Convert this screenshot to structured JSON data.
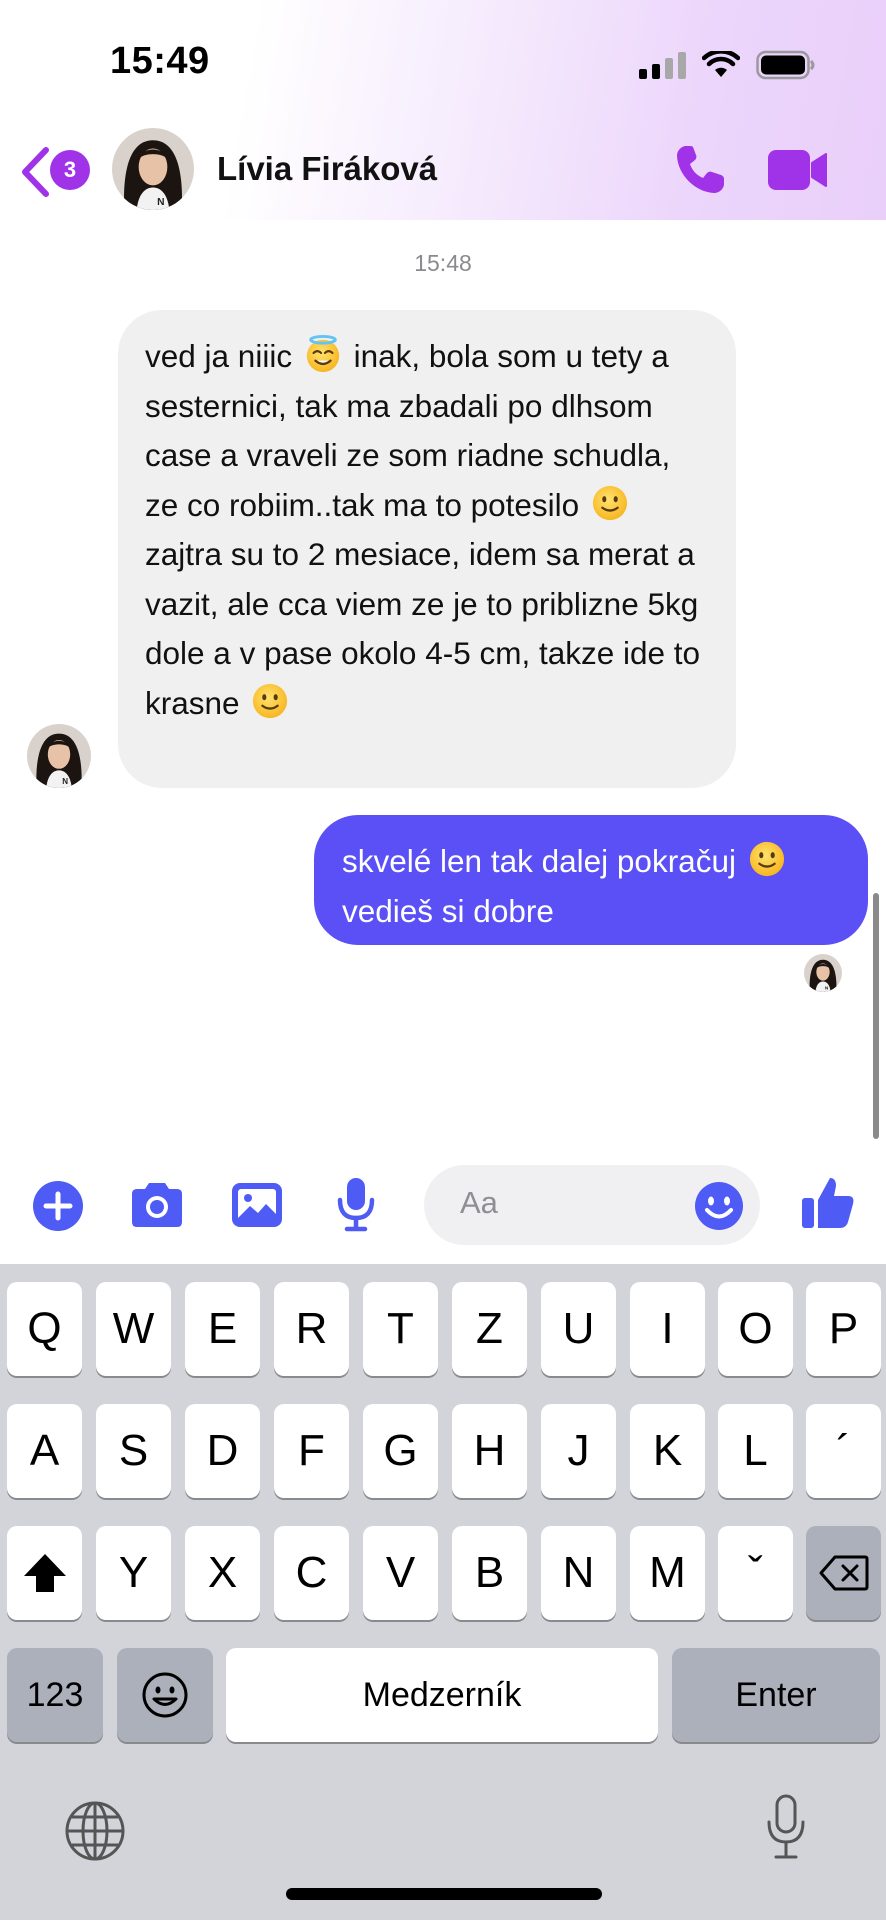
{
  "status_bar": {
    "time": "15:49",
    "icons": [
      "cellular-signal-icon",
      "wifi-icon",
      "battery-icon"
    ]
  },
  "header": {
    "back_icon": "chevron-left-icon",
    "unread_count": "3",
    "contact_name": "Lívia Firáková",
    "actions": [
      "phone-icon",
      "video-camera-icon"
    ],
    "accent_color": "#a033e8"
  },
  "chat": {
    "timestamp": "15:48",
    "messages": [
      {
        "direction": "incoming",
        "text": {
          "part1": "ved ja niiic",
          "part2": " inak, bola som u tety a sesternici, tak ma zbadali po dlhsom case a vraveli ze som riadne schudla, ze co robiim..tak ma to potesilo",
          "part3": " zajtra su to 2 mesiace, idem sa merat a vazit, ale cca viem ze je to priblizne 5kg dole a v pase okolo 4-5 cm, takze ide to krasne"
        },
        "emojis": [
          "halo-smile-emoji",
          "slight-smile-emoji",
          "slight-smile-emoji"
        ]
      },
      {
        "direction": "outgoing",
        "text": {
          "part1": "skvelé len tak dalej pokračuj",
          "part2": "vedieš si dobre"
        },
        "emojis": [
          "slight-smile-emoji"
        ],
        "bubble_color": "#5b50f5"
      }
    ]
  },
  "composer": {
    "buttons": [
      "plus-icon",
      "camera-icon",
      "image-icon",
      "microphone-icon"
    ],
    "placeholder": "Aa",
    "emoji_button": "emoji-icon",
    "like_button": "thumbs-up-icon",
    "icon_color": "#4e5bf5"
  },
  "keyboard": {
    "row1": [
      "Q",
      "W",
      "E",
      "R",
      "T",
      "Z",
      "U",
      "I",
      "O",
      "P"
    ],
    "row2": [
      "A",
      "S",
      "D",
      "F",
      "G",
      "H",
      "J",
      "K",
      "L",
      "´"
    ],
    "row3": [
      "Y",
      "X",
      "C",
      "V",
      "B",
      "N",
      "M",
      "ˇ"
    ],
    "numbers_key": "123",
    "space_key": "Medzerník",
    "enter_key": "Enter",
    "shift_icon": "shift-icon",
    "delete_icon": "backspace-icon",
    "emoji_key_icon": "emoji-icon",
    "globe_icon": "globe-icon",
    "dictation_icon": "microphone-icon"
  }
}
